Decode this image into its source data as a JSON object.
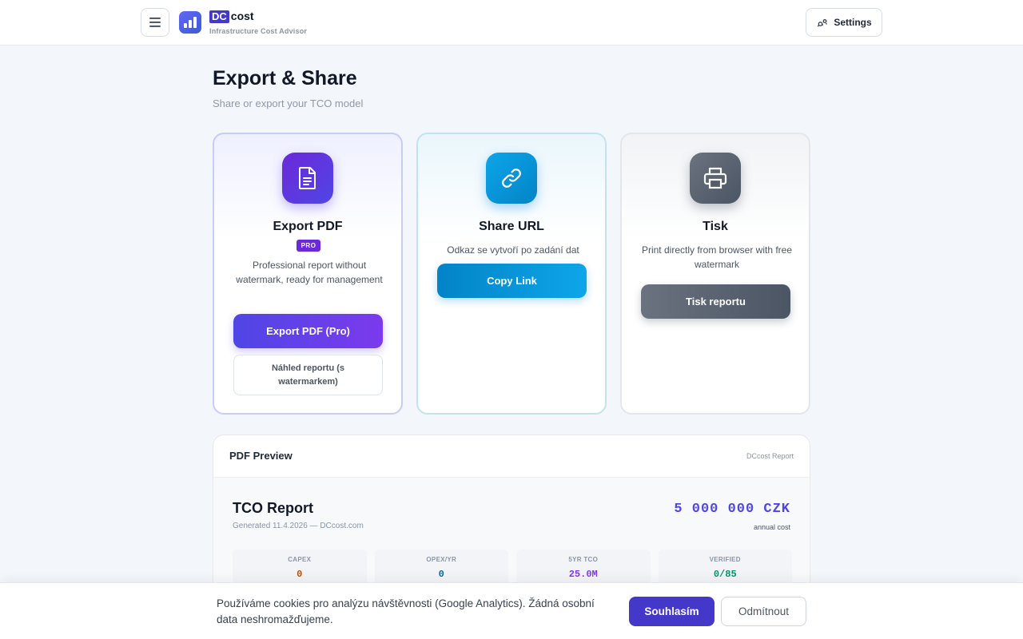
{
  "header": {
    "brand_dc": "DC",
    "brand_cost": "cost",
    "brand_subtitle": "Infrastructure Cost Advisor",
    "settings_label": "Settings"
  },
  "page": {
    "title": "Export & Share",
    "subtitle": "Share or export your TCO model"
  },
  "cards": {
    "pdf": {
      "title": "Export PDF",
      "badge": "PRO",
      "description": "Professional report without watermark, ready for management",
      "button": "Export PDF (Pro)",
      "secondary_button": "Náhled reportu (s watermarkem)"
    },
    "share": {
      "title": "Share URL",
      "description": "Odkaz se vytvoří po zadání dat",
      "button": "Copy Link"
    },
    "print": {
      "title": "Tisk",
      "description": "Print directly from browser with free watermark",
      "button": "Tisk reportu"
    }
  },
  "preview": {
    "title": "PDF Preview",
    "tag": "DCcost Report",
    "report_title": "TCO Report",
    "generated": "Generated 11.4.2026 — DCcost.com",
    "amount": "5 000 000 CZK",
    "amount_label": "annual cost",
    "stats": [
      {
        "label": "CAPEX",
        "value": "0",
        "color": "#b45309"
      },
      {
        "label": "OPEX/YR",
        "value": "0",
        "color": "#0369a1"
      },
      {
        "label": "5YR TCO",
        "value": "25.0M",
        "color": "#7c3aed"
      },
      {
        "label": "VERIFIED",
        "value": "0/85",
        "color": "#059669"
      }
    ]
  },
  "cookie": {
    "text": "Používáme cookies pro analýzu návštěvnosti (Google Analytics). Žádná osobní data neshromažďujeme.",
    "accept": "Souhlasím",
    "reject": "Odmítnout"
  }
}
